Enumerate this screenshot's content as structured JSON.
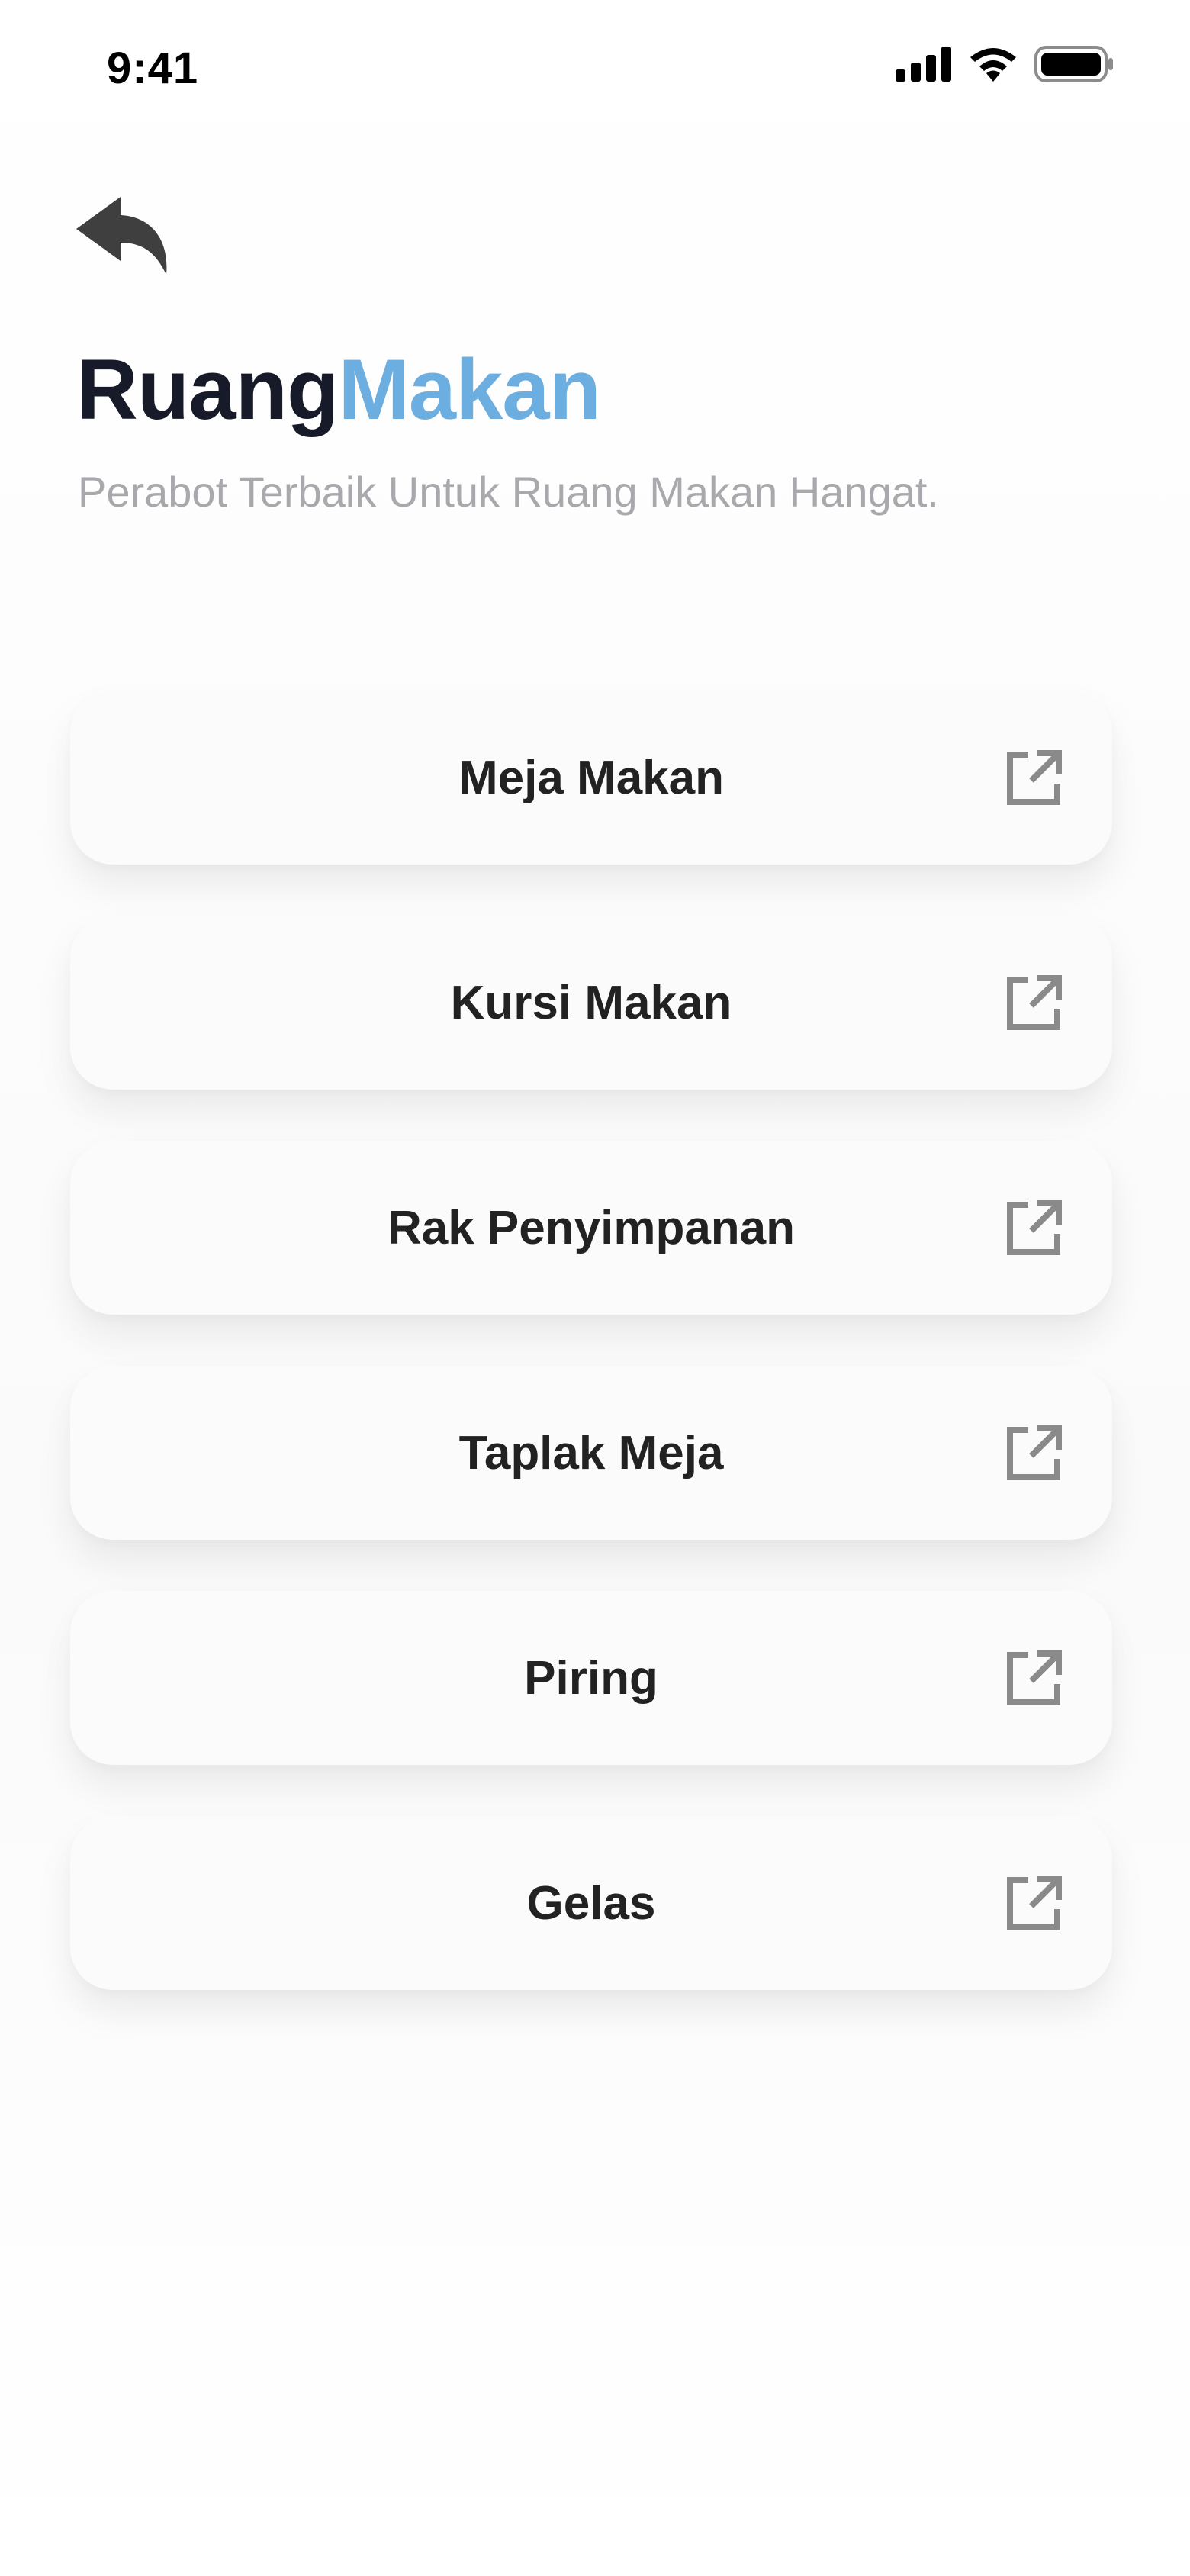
{
  "status_bar": {
    "time": "9:41",
    "icons": [
      "signal-icon",
      "wifi-icon",
      "battery-icon"
    ]
  },
  "header": {
    "back_icon": "back-arrow-icon",
    "title_part1": "Ruang",
    "title_part2": "Makan",
    "subtitle": "Perabot Terbaik Untuk Ruang Makan Hangat."
  },
  "colors": {
    "title_dark": "#171a28",
    "title_accent": "#6caee0",
    "subtitle": "#a9a9ad",
    "card_bg": "#fbfbfb",
    "icon": "#8a8a8a"
  },
  "items": [
    {
      "label": "Meja Makan",
      "icon": "external-link-icon"
    },
    {
      "label": "Kursi Makan",
      "icon": "external-link-icon"
    },
    {
      "label": "Rak Penyimpanan",
      "icon": "external-link-icon"
    },
    {
      "label": "Taplak Meja",
      "icon": "external-link-icon"
    },
    {
      "label": "Piring",
      "icon": "external-link-icon"
    },
    {
      "label": "Gelas",
      "icon": "external-link-icon"
    }
  ]
}
